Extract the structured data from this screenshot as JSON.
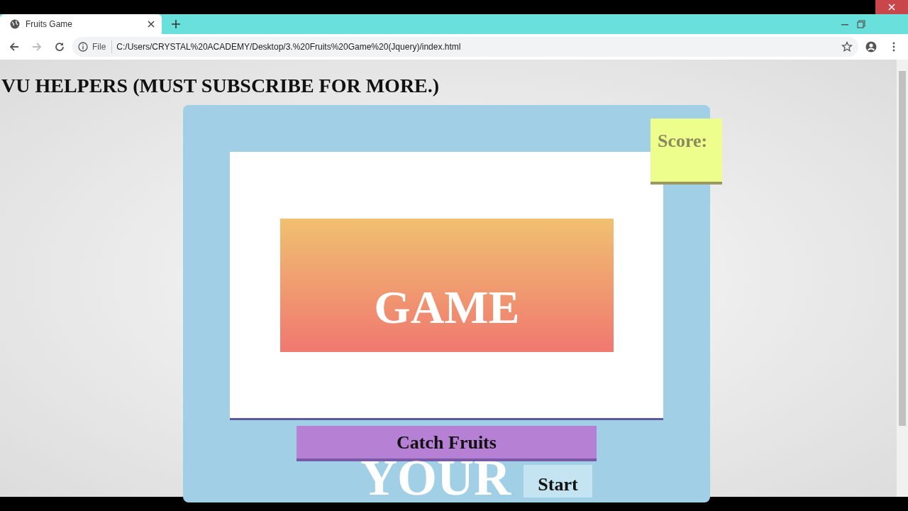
{
  "browser": {
    "tab": {
      "title": "Fruits Game",
      "selected": true
    },
    "address": {
      "scheme": "File",
      "url": "C:/Users/CRYSTAL%20ACADEMY/Desktop/3.%20Fruits%20Game%20(Jquery)/index.html"
    }
  },
  "page": {
    "heading": "VU HELPERS (MUST SUBSCRIBE FOR MORE.)",
    "score": {
      "label": "Score:"
    },
    "game_over": {
      "text": "GAME"
    },
    "title_button": "Catch Fruits",
    "overlay_text": "YOUR",
    "start_button": "Start"
  }
}
